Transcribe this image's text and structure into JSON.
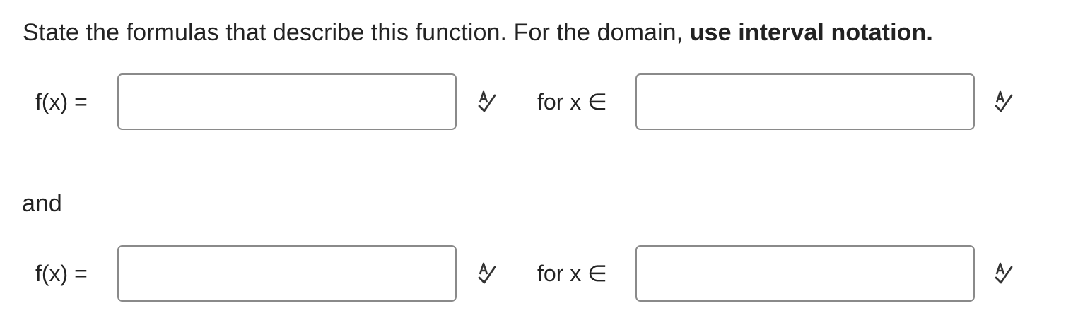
{
  "instruction": {
    "text": "State the formulas that describe this function.  For the domain, ",
    "emphasis": "use interval notation."
  },
  "pieces": [
    {
      "function_label": "f(x) =",
      "formula_value": "",
      "domain_label": "for x ∈",
      "domain_value": "",
      "formula_check_icon": "spellcheck-icon",
      "domain_check_icon": "spellcheck-icon"
    },
    {
      "function_label": "f(x) =",
      "formula_value": "",
      "domain_label": "for x ∈",
      "domain_value": "",
      "formula_check_icon": "spellcheck-icon",
      "domain_check_icon": "spellcheck-icon"
    }
  ],
  "connector": "and",
  "colors": {
    "text": "#222222",
    "input_border": "#8a8a8a",
    "icon": "#333333"
  }
}
